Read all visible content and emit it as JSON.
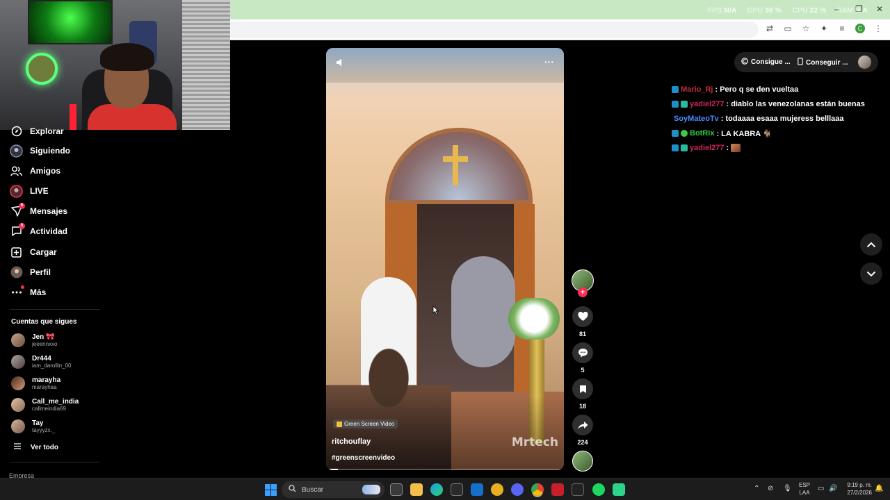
{
  "browser": {
    "perf_fps_label": "FPS",
    "perf_fps": "N/A",
    "perf_gpu_label": "GPU",
    "perf_gpu": "36 %",
    "perf_cpu_label": "CPU",
    "perf_cpu": "22 %",
    "perf_ram_label": "RAM",
    "perf_ram": "N/A",
    "profile_initial": "C"
  },
  "sidebar": {
    "items": [
      {
        "label": "Explorar",
        "icon": "compass-icon"
      },
      {
        "label": "Siguiendo",
        "icon": "following-icon"
      },
      {
        "label": "Amigos",
        "icon": "friends-icon"
      },
      {
        "label": "LIVE",
        "icon": "live-icon"
      },
      {
        "label": "Mensajes",
        "icon": "messages-icon",
        "badge": "6"
      },
      {
        "label": "Actividad",
        "icon": "activity-icon",
        "badge": "5"
      },
      {
        "label": "Cargar",
        "icon": "upload-icon"
      },
      {
        "label": "Perfil",
        "icon": "profile-icon"
      },
      {
        "label": "Más",
        "icon": "more-icon"
      }
    ],
    "following_title": "Cuentas que sigues",
    "accounts": [
      {
        "name": "Jen 🎀",
        "handle": "jeeennxxo"
      },
      {
        "name": "Dr444",
        "handle": "iam_darollin_00"
      },
      {
        "name": "marayha",
        "handle": "marayhaa"
      },
      {
        "name": "Call_me_india",
        "handle": "callmeindia69"
      },
      {
        "name": "Tay",
        "handle": "tayyyzx._"
      }
    ],
    "see_all": "Ver todo",
    "footer_label": "Empresa"
  },
  "video": {
    "green_screen_label": "Green Screen Video",
    "username": "ritchouflay",
    "hashtag": "#greenscreenvideo",
    "watermark": "Mrtech",
    "more": "···",
    "progress": 0.05
  },
  "rail": {
    "likes": "81",
    "comments": "5",
    "saves": "18",
    "shares": "224"
  },
  "top_actions": {
    "get_coins": "Consigue ...",
    "get_app": "Conseguir ..."
  },
  "chat": [
    {
      "user": "Mario_Rj",
      "color": "#c0303a",
      "message": ": Pero q se den vueltaa"
    },
    {
      "user": "yadiel277",
      "color": "#d4245c",
      "message": ": diablo las venezolanas están buenas"
    },
    {
      "user": "SoyMateoTv",
      "color": "#4a8cff",
      "message": ": todaaaa esaaa mujeress belllaaa"
    },
    {
      "user": "BotRix",
      "color": "#2ecc40",
      "message": ": LA KABRA 🐐"
    },
    {
      "user": "yadiel277",
      "color": "#d4245c",
      "message": ":"
    }
  ],
  "taskbar": {
    "search_placeholder": "Buscar",
    "lang_line1": "ESP",
    "lang_line2": "LAA",
    "time": "9:19 p. m.",
    "date": "27/2/2026"
  }
}
